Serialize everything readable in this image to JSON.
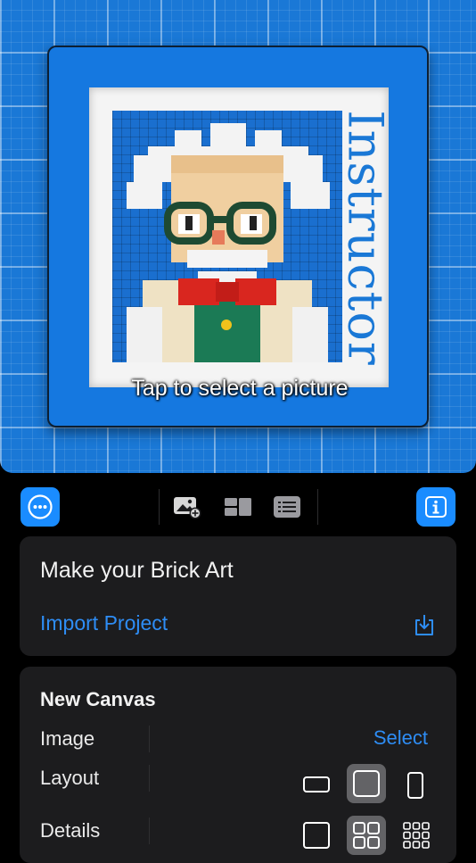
{
  "preview": {
    "vertical_title": "Instructor",
    "caption": "Tap to select a picture"
  },
  "toolbar": {
    "more_icon": "ellipsis-circle-icon",
    "tools": [
      "add-photo-icon",
      "bricks-layout-icon",
      "list-details-icon"
    ],
    "info_icon": "info-icon"
  },
  "project_card": {
    "title": "Make your Brick Art",
    "import_label": "Import Project",
    "import_icon": "download-tray-icon"
  },
  "new_canvas": {
    "title": "New Canvas",
    "rows": [
      {
        "label": "Image",
        "value": "Select"
      },
      {
        "label": "Layout",
        "options": [
          "landscape",
          "square",
          "portrait"
        ],
        "selected": "square"
      },
      {
        "label": "Details",
        "options": [
          "low",
          "medium",
          "high"
        ],
        "selected": "medium"
      }
    ]
  },
  "colors": {
    "accent": "#1a8cff",
    "link": "#2e8df5",
    "canvas_blue": "#1a78d6",
    "card_bg": "#1c1c1e"
  }
}
